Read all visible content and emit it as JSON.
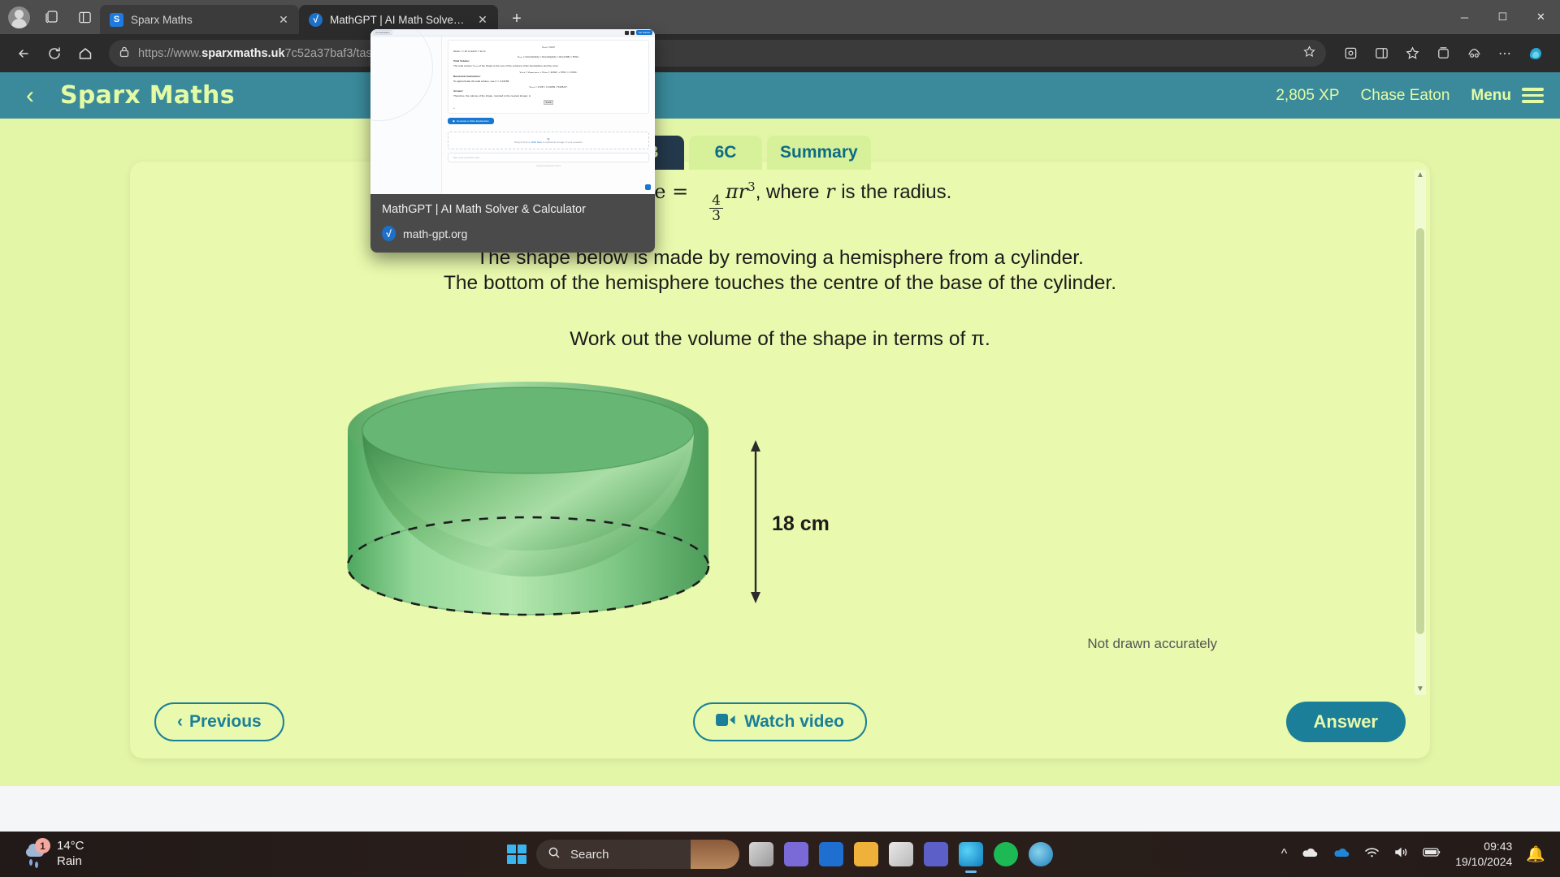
{
  "browser": {
    "tabs": [
      {
        "title": "Sparx Maths",
        "favicon": "S",
        "active": false
      },
      {
        "title": "MathGPT | AI Math Solver & Calc",
        "favicon": "√",
        "active": true
      }
    ],
    "new_tab_label": "+",
    "nav": {
      "back": "←",
      "reload": "↻",
      "home": "⌂"
    },
    "address": {
      "lock_icon": "lock-icon",
      "url_prefix": "https://www.",
      "url_host": "sparxmaths.uk",
      "url_suffix": "7c52a37baf3/task/6/item/2",
      "star_icon": "favorite-star-icon"
    },
    "window_controls": {
      "minimize": "─",
      "maximize": "☐",
      "close": "✕"
    }
  },
  "tab_preview": {
    "title": "MathGPT | AI Math Solver & Calculator",
    "site": "math-gpt.org",
    "thumb": {
      "chip_label": "Conversation",
      "get_started": "Get Started",
      "eq_top": "Vₛₚₕ = ⅔πr³",
      "given": "Given r = 12 m and h = 12 m:",
      "eq_given": "Vₛₚₕ = ⅔π(12)²(12) = ⅔π(144)(12) = ⅔π(1728) = 576π.",
      "total_heading": "Total Volume:",
      "total_text": "The total volume Vₜₒₜₐₗ of the shape is the sum of the volumes of the hemisphere and the cone:",
      "total_eq": "Vₜₒₜₐₗ = Vₕₑₘᵢₛₚₕₑᵣₑ + Vᴄₒₙₑ = 1152π + 576π = 1728π.",
      "numeric_heading": "Numerical Calculation:",
      "numeric_text": "To approximate the total volume, use π ≈ 3.14159:",
      "numeric_eq": "Vₜₒₜₐₗ ≈ 1728 × 3.14159 ≈ 5428.67.",
      "answer_heading": "Answer:",
      "answer_text": "Therefore, the volume of the shape, rounded to the nearest integer, is",
      "answer_value": "5429",
      "video_button": "Generate a Video Explanation",
      "upload_prefix": "Drag & drop or ",
      "upload_link": "click here",
      "upload_suffix": " to upload an image of your question",
      "input_placeholder": "Type your question here...",
      "footer": "Generic questions? Terms"
    }
  },
  "sparx": {
    "back_icon": "back-chevron-icon",
    "logo": "Sparx Maths",
    "xp": "2,805 XP",
    "user": "Chase Eaton",
    "menu_label": "Menu",
    "tabs": [
      {
        "label": "✕",
        "kind": "mark"
      },
      {
        "label": "6B",
        "kind": "active"
      },
      {
        "label": "6C",
        "kind": "normal"
      },
      {
        "label": "Summary",
        "kind": "normal"
      }
    ],
    "question": {
      "formula_lead": "phere =",
      "formula_num": "4",
      "formula_den": "3",
      "formula_tail": "πr",
      "formula_exp": "3",
      "formula_where": ", where",
      "formula_var": "r",
      "formula_rest": "is the radius.",
      "line1": "The shape below is made by removing a hemisphere from a cylinder.",
      "line2": "The bottom of the hemisphere touches the centre of the base of the cylinder.",
      "line3": "Work out the volume of the shape in terms of π.",
      "dimension_label": "18 cm",
      "disclaimer": "Not drawn accurately"
    },
    "footer": {
      "previous": "Previous",
      "watch_video": "Watch video",
      "answer": "Answer"
    }
  },
  "taskbar": {
    "weather": {
      "temperature": "14°C",
      "condition": "Rain",
      "badge": "1"
    },
    "search_placeholder": "Search",
    "clock": {
      "time": "09:43",
      "date": "19/10/2024"
    }
  },
  "colors": {
    "sparx_header": "#3a8a9b",
    "page_bg": "#e3f5a7",
    "card_bg": "#e9f9ad",
    "accent_text": "#e4fba5",
    "button_teal": "#1b7f99",
    "active_tab": "#23384a"
  }
}
